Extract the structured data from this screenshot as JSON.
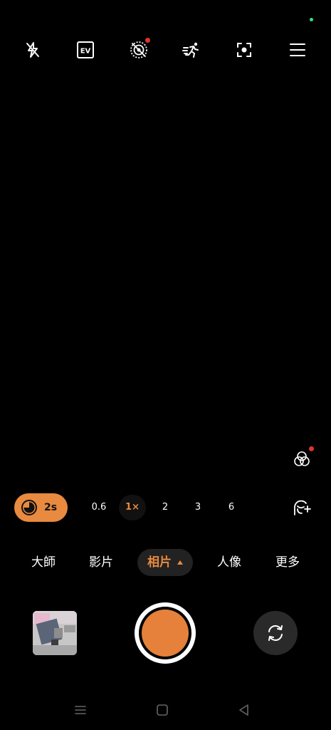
{
  "top_toolbar": {
    "icons": [
      "flash-off-icon",
      "exposure-ev-icon",
      "live-photo-off-icon",
      "motion-capture-icon",
      "focus-icon",
      "menu-icon"
    ],
    "ev_label": "EV"
  },
  "zoom": {
    "timer_label": "2s",
    "options": [
      "0.6",
      "1×",
      "2",
      "3",
      "6"
    ],
    "active": "1×"
  },
  "modes": {
    "items": [
      "大師",
      "影片",
      "相片",
      "人像",
      "更多"
    ],
    "active": "相片"
  },
  "colors": {
    "accent": "#e88a3f",
    "shutter_core": "#e5813a",
    "notification_dot": "#e0352b",
    "status_dot": "#3ddc84"
  }
}
